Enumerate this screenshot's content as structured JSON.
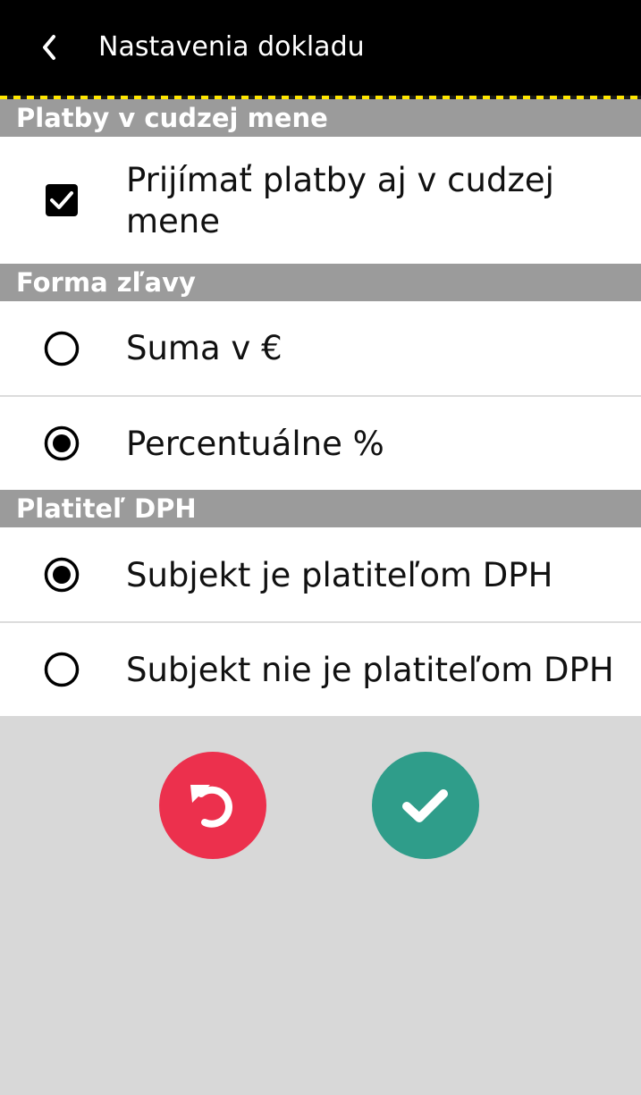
{
  "header": {
    "title": "Nastavenia dokladu",
    "back_icon": "chevron-left-icon"
  },
  "sections": {
    "foreign_currency": {
      "title": "Platby v cudzej mene",
      "option": {
        "label_line1": "Prijímať platby aj v cudzej",
        "label_line2": "mene",
        "checked": true
      }
    },
    "discount": {
      "title": "Forma zľavy",
      "options": [
        {
          "label": "Suma v €",
          "selected": false
        },
        {
          "label": "Percentuálne %",
          "selected": true
        }
      ]
    },
    "vat": {
      "title": "Platiteľ DPH",
      "options": [
        {
          "label": "Subjekt je platiteľom DPH",
          "selected": true
        },
        {
          "label": "Subjekt nie je platiteľom DPH",
          "selected": false
        }
      ]
    }
  },
  "actions": {
    "reset_icon": "undo-icon",
    "confirm_icon": "checkmark-icon"
  },
  "colors": {
    "topbar": "#000000",
    "accent_stripe": "#ffe600",
    "section_header": "#9b9b9b",
    "background": "#d8d8d8",
    "reset_button": "#ec304d",
    "confirm_button": "#2f9d8a"
  }
}
